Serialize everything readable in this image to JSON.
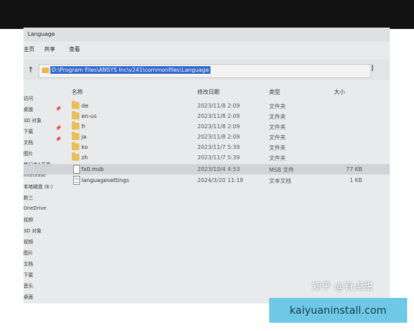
{
  "window": {
    "title": "Language"
  },
  "ribbon": {
    "tab_file": "主页",
    "tab_share": "共享",
    "tab_view": "查看"
  },
  "address": {
    "path": "D:\\Program Files\\ANSYS Inc\\v241\\commonfiles\\Language"
  },
  "columns": {
    "name": "名称",
    "modified": "修改日期",
    "type": "类型",
    "size": "大小"
  },
  "left_pane": [
    "访问",
    "桌面",
    "3D 对象",
    "下载",
    "文档",
    "图片",
    "笔记本1平面",
    "Intel99se",
    "本地磁盘 (E:)",
    "新三",
    "OneDrive",
    "视频",
    "3D 对象",
    "视频",
    "图片",
    "文档",
    "下载",
    "音乐",
    "桌面"
  ],
  "files": [
    {
      "name": "de",
      "date": "2023/11/8 2:09",
      "type": "文件夹",
      "size": "",
      "kind": "folder"
    },
    {
      "name": "en-us",
      "date": "2023/11/8 2:09",
      "type": "文件夹",
      "size": "",
      "kind": "folder"
    },
    {
      "name": "fr",
      "date": "2023/11/8 2:09",
      "type": "文件夹",
      "size": "",
      "kind": "folder"
    },
    {
      "name": "ja",
      "date": "2023/11/8 2:09",
      "type": "文件夹",
      "size": "",
      "kind": "folder"
    },
    {
      "name": "ko",
      "date": "2023/11/7 5:39",
      "type": "文件夹",
      "size": "",
      "kind": "folder"
    },
    {
      "name": "zh",
      "date": "2023/11/7 5:39",
      "type": "文件夹",
      "size": "",
      "kind": "folder"
    },
    {
      "name": "fx0.msb",
      "date": "2023/10/4 4:53",
      "type": "MSB 文件",
      "size": "77 KB",
      "kind": "file"
    },
    {
      "name": "languagesettings",
      "date": "2024/3/20 11:18",
      "type": "文本文档",
      "size": "1 KB",
      "kind": "txt"
    }
  ],
  "watermark": "知乎 @有点甜",
  "site_badge": "kaiyuaninstall.com"
}
